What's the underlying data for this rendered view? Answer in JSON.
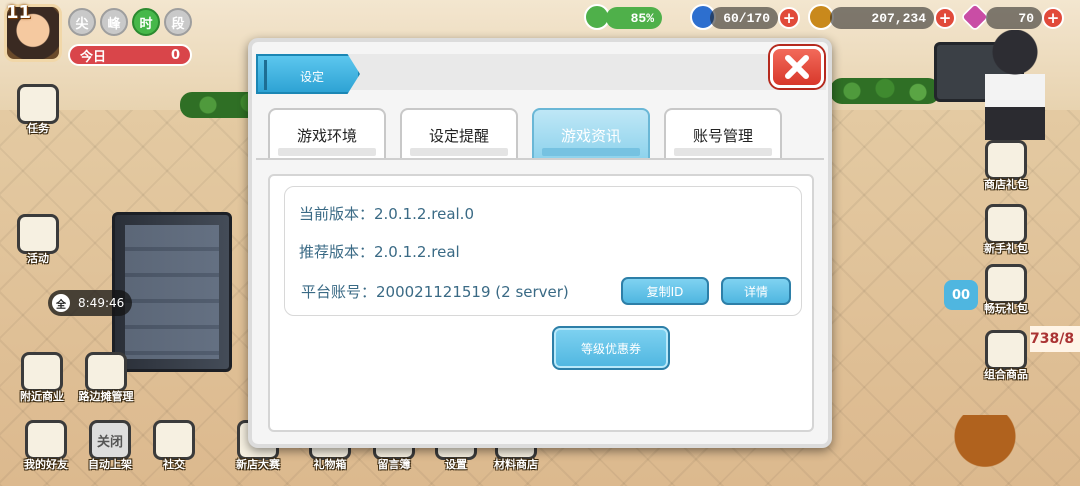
{
  "hud": {
    "level": "11",
    "time_slots": [
      "尖",
      "峰",
      "时",
      "段"
    ],
    "today_label": "今日",
    "today_value": "0",
    "percent": "85%",
    "energy": "60/170",
    "coins": "207,234",
    "gems": "70",
    "plus": "+"
  },
  "left_icons": {
    "task": "任务",
    "event": "活动",
    "neighbor_shop": "附近商业",
    "street_manage": "路边摊管理",
    "my_friends": "我的好友",
    "close": "关闭",
    "auto_open": "自动上架",
    "social": "社交"
  },
  "clock": {
    "icon": "全",
    "time": "8:49:46"
  },
  "bottom_icons": [
    "新店大赛",
    "礼物箱",
    "留言簿",
    "设置",
    "材料商店"
  ],
  "right_icons": {
    "store_gift": "商店礼包",
    "newbie_gift": "新手礼包",
    "limited_gift": "畅玩礼包",
    "combo_shop": "组合商品"
  },
  "right_edge": {
    "counter_a": "00",
    "counter_b": "738/8"
  },
  "dialog": {
    "title": "设定",
    "tabs": [
      "游戏环境",
      "设定提醒",
      "游戏资讯",
      "账号管理"
    ],
    "active_tab": 2,
    "current_version": "当前版本：2.0.1.2.real.0",
    "recommended_version": "推荐版本：2.0.1.2.real",
    "platform_account": "平台账号：200021121519 (2 server)",
    "copy_id_button": "复制ID",
    "details_button": "详情",
    "coupon_button": "等级优惠券"
  },
  "colors": {
    "tab_active": "#8dd2ec",
    "close_red": "#d8382b",
    "info_text": "#3a6a85"
  }
}
